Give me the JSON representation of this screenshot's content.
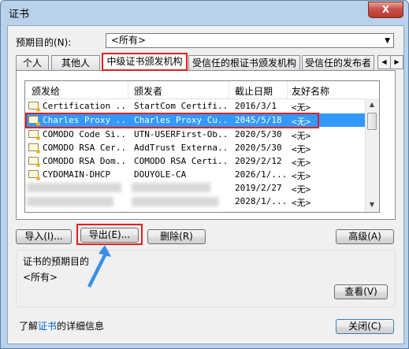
{
  "window": {
    "title": "证书",
    "close_label": "X"
  },
  "purpose": {
    "label": "预期目的(N):",
    "selected": "<所有>"
  },
  "tabs": [
    {
      "label": "个人"
    },
    {
      "label": "其他人"
    },
    {
      "label": "中级证书颁发机构"
    },
    {
      "label": "受信任的根证书颁发机构"
    },
    {
      "label": "受信任的发布者"
    }
  ],
  "list": {
    "headers": {
      "issued_to": "颁发给",
      "issued_by": "颁发者",
      "expiry": "截止日期",
      "friendly_name": "友好名称"
    },
    "rows": [
      {
        "issued_to": "Certification ...",
        "issued_by": "StartCom Certifi...",
        "expiry": "2016/3/1",
        "friendly_name": "<无>"
      },
      {
        "issued_to": "Charles Proxy ...",
        "issued_by": "Charles Proxy Cu...",
        "expiry": "2045/5/18",
        "friendly_name": "<无>"
      },
      {
        "issued_to": "COMODO Code Si...",
        "issued_by": "UTN-USERFirst-Ob...",
        "expiry": "2020/5/30",
        "friendly_name": "<无>"
      },
      {
        "issued_to": "COMODO RSA Cer...",
        "issued_by": "AddTrust Externa...",
        "expiry": "2020/5/30",
        "friendly_name": "<无>"
      },
      {
        "issued_to": "COMODO RSA Dom...",
        "issued_by": "COMODO RSA Certi...",
        "expiry": "2029/2/12",
        "friendly_name": "<无>"
      },
      {
        "issued_to": "CYDOMAIN-DHCP",
        "issued_by": "DOUYOLE-CA",
        "expiry": "2026/1/...",
        "friendly_name": "<无>"
      },
      {
        "issued_to": "",
        "issued_by": "",
        "expiry": "2019/2/27",
        "friendly_name": "<无>"
      },
      {
        "issued_to": "",
        "issued_by": "",
        "expiry": "2028/1/...",
        "friendly_name": "<无>"
      }
    ]
  },
  "buttons": {
    "import": "导入(I)...",
    "export": "导出(E)...",
    "remove": "删除(R)",
    "advanced": "高级(A)",
    "view": "查看(V)",
    "close": "关闭(C)"
  },
  "group": {
    "label": "证书的预期目的",
    "value": "<所有>"
  },
  "info": {
    "prefix": "了解",
    "link": "证书",
    "suffix": "的详细信息"
  },
  "colors": {
    "selection": "#3399ff",
    "highlight": "#e02020",
    "annotation_arrow": "#3a8ee6"
  }
}
